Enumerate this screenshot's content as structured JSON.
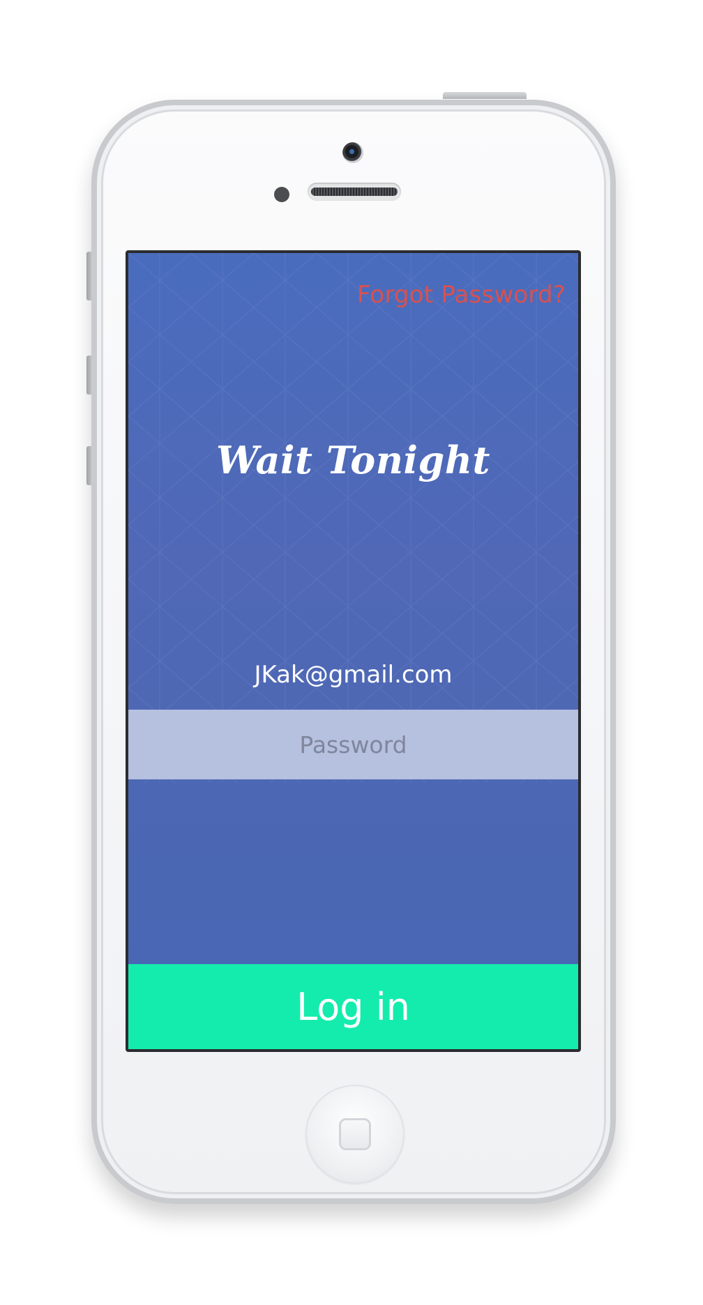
{
  "login_screen": {
    "forgot_password": "Forgot Password?",
    "brand_title": "Wait Tonight",
    "email_value": "JKak@gmail.com",
    "password_placeholder": "Password",
    "login_button": "Log in"
  },
  "colors": {
    "background_blue": "#4b68b6",
    "forgot_link": "#d9514f",
    "password_field": "#b6c1e0",
    "login_button": "#14ecad"
  },
  "icons": {
    "home_button": "home-button-icon",
    "front_camera": "camera-icon",
    "speaker": "speaker-grille-icon"
  }
}
